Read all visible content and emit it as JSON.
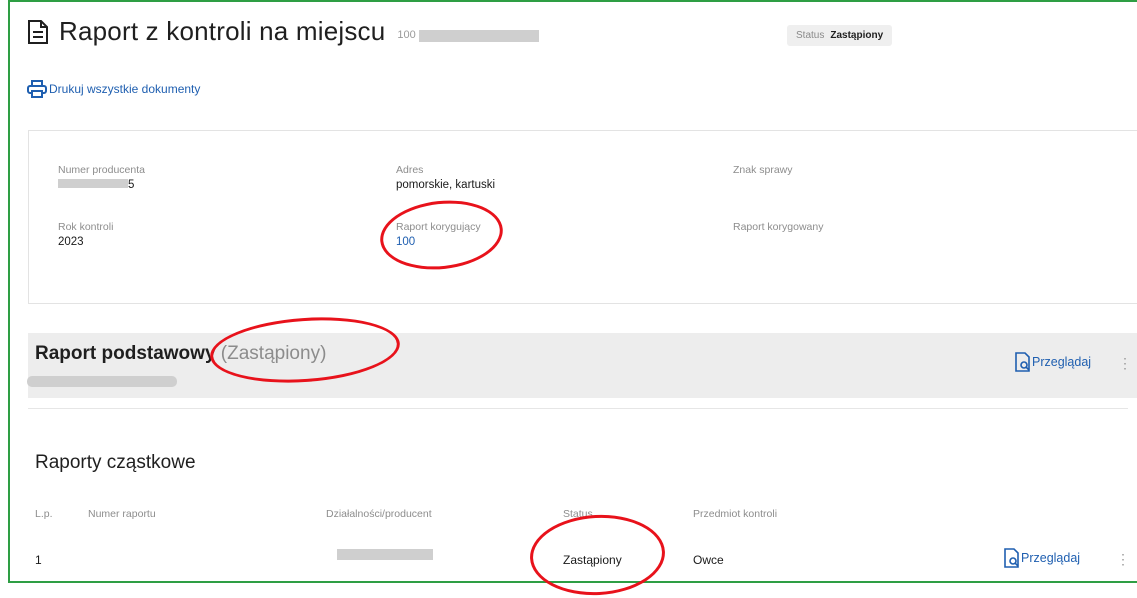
{
  "header": {
    "title": "Raport z kontroli na miejscu",
    "id_prefix": "100",
    "status_label": "Status",
    "status_value": "Zastąpiony"
  },
  "print_link": {
    "label": "Drukuj wszystkie dokumenty",
    "icon": "printer-icon"
  },
  "details": {
    "producer_number": {
      "label": "Numer producenta",
      "value_suffix": "5"
    },
    "address": {
      "label": "Adres",
      "value": "pomorskie, kartuski"
    },
    "case_mark": {
      "label": "Znak sprawy",
      "value": ""
    },
    "control_year": {
      "label": "Rok kontroli",
      "value": "2023"
    },
    "correcting_report": {
      "label": "Raport korygujący",
      "value": "100"
    },
    "corrected_report": {
      "label": "Raport korygowany",
      "value": ""
    }
  },
  "basic_report": {
    "title": "Raport podstawowy",
    "status": "(Zastąpiony)",
    "browse_label": "Przeglądaj",
    "more_icon": "kebab-menu-icon"
  },
  "partial_reports": {
    "title": "Raporty cząstkowe",
    "columns": [
      "L.p.",
      "Numer raportu",
      "Działalności/producent",
      "Status",
      "Przedmiot kontroli"
    ],
    "rows": [
      {
        "lp": "1",
        "number": "",
        "producer": "",
        "status": "Zastąpiony",
        "subject": "Owce",
        "browse_label": "Przeglądaj"
      }
    ]
  },
  "colors": {
    "link": "#1f5fb0",
    "frame": "#2e9e44",
    "annotation": "#e8121b"
  }
}
